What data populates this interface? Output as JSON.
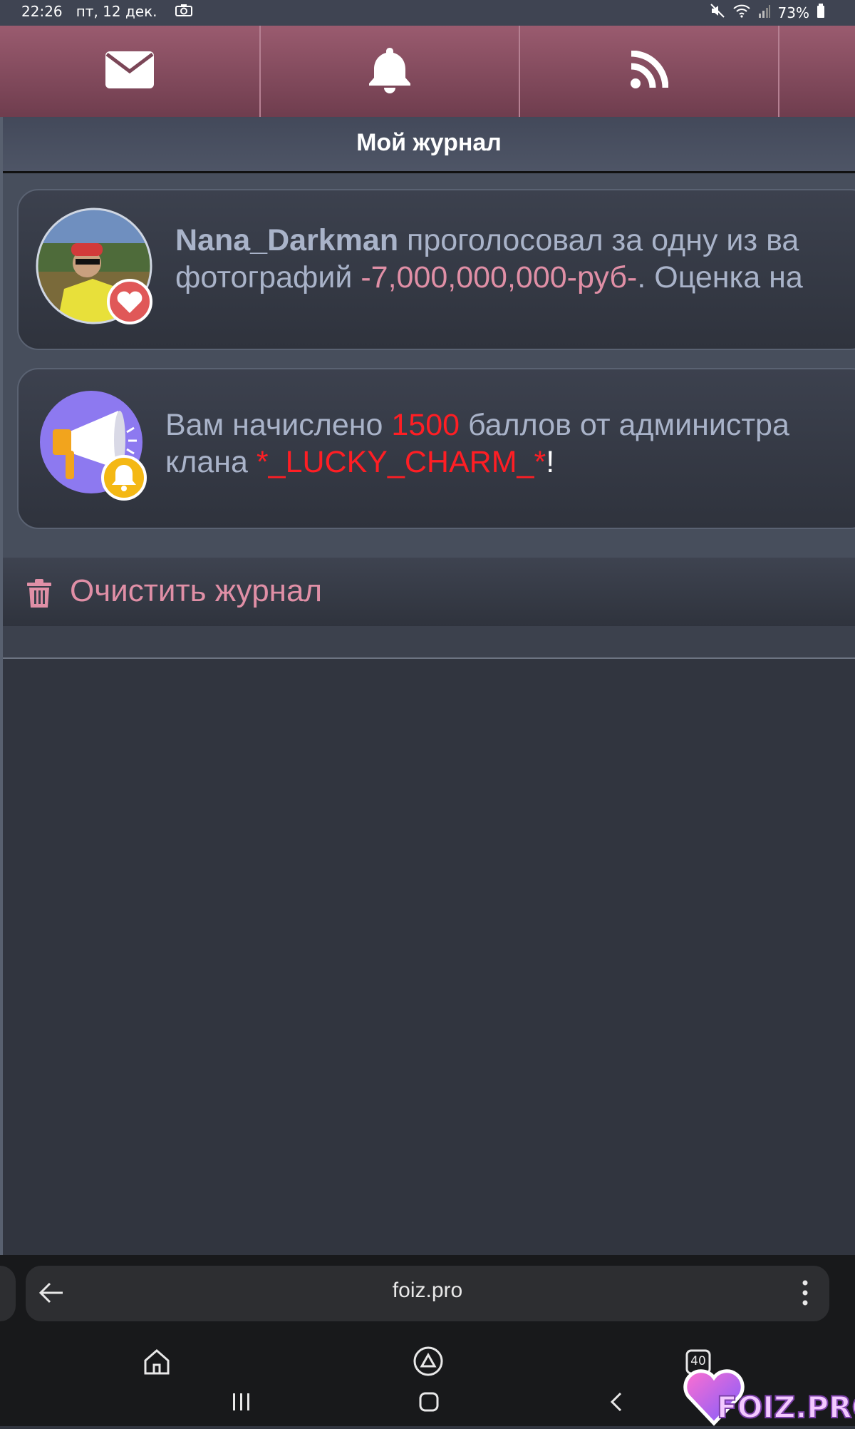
{
  "status_bar": {
    "time": "22:26",
    "date": "пт, 12 дек.",
    "battery": "73%"
  },
  "tabs": [
    {
      "icon": "envelope-icon"
    },
    {
      "icon": "bell-icon"
    },
    {
      "icon": "rss-icon"
    }
  ],
  "page": {
    "title": "Мой журнал"
  },
  "journal": [
    {
      "avatar": "user-avatar",
      "badge": "heart-badge-icon",
      "user": "Nana_Darkman",
      "text1": " проголосовал за одну из ва",
      "line2_a": "фотографий ",
      "photo": "-7,000,000,000-руб-",
      "line2_b": ". Оценка на"
    },
    {
      "avatar": "megaphone-icon",
      "badge": "bell-badge-icon",
      "line1_a": "Вам начислено ",
      "points": "1500",
      "line1_b": " баллов от администра",
      "line2_a": "клана ",
      "clan": "*_LUCKY_CHARM_*",
      "line2_b": "!"
    }
  ],
  "clear_button": {
    "label": "Очистить журнал"
  },
  "browser": {
    "url": "foiz.pro",
    "tab_count": "40"
  },
  "watermark": "FOIZ.PRO",
  "colors": {
    "accent_pink": "#e08fa6",
    "highlight_red": "#ff1e24",
    "tab_bar": "#8a4f62"
  }
}
